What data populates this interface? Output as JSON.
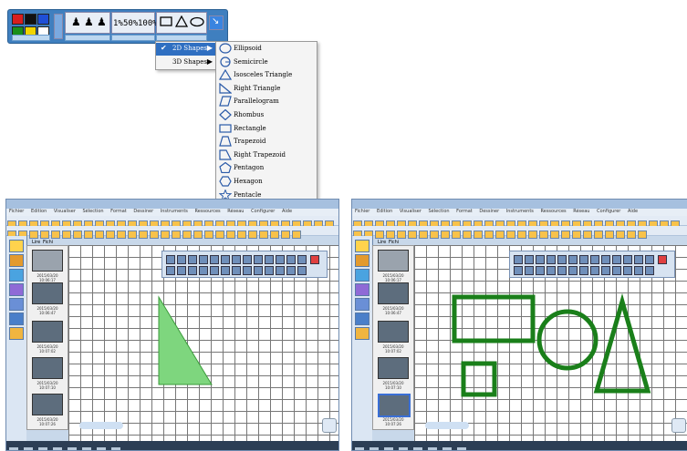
{
  "toolbar": {
    "colors": [
      "#d81e1e",
      "#111111",
      "#1f4fd6",
      "#1a8f1a",
      "#f0d400",
      "#ffffff"
    ],
    "thickness_labels": [
      "1%",
      "50%",
      "100%"
    ],
    "shape_icons": [
      "rectangle-icon",
      "triangle-icon",
      "ellipse-icon"
    ]
  },
  "shapes_menu": {
    "items": [
      {
        "label": "2D Shapes",
        "selected": true
      },
      {
        "label": "3D Shapes",
        "selected": false
      }
    ]
  },
  "shapes_2d_submenu": {
    "items": [
      {
        "label": "Ellipsoid",
        "icon": "ellipse-icon"
      },
      {
        "label": "Semicircle",
        "icon": "semicircle-icon"
      },
      {
        "label": "Isosceles Triangle",
        "icon": "isosceles-triangle-icon"
      },
      {
        "label": "Right Triangle",
        "icon": "right-triangle-icon"
      },
      {
        "label": "Parallelogram",
        "icon": "parallelogram-icon"
      },
      {
        "label": "Rhombus",
        "icon": "rhombus-icon"
      },
      {
        "label": "Rectangle",
        "icon": "rectangle-icon"
      },
      {
        "label": "Trapezoid",
        "icon": "trapezoid-icon"
      },
      {
        "label": "Right Trapezoid",
        "icon": "right-trapezoid-icon"
      },
      {
        "label": "Pentagon",
        "icon": "pentagon-icon"
      },
      {
        "label": "Hexagon",
        "icon": "hexagon-icon"
      },
      {
        "label": "Pentacle",
        "icon": "pentacle-icon"
      }
    ]
  },
  "app_left": {
    "title": "",
    "shape_color": "#7ed67e",
    "thumb_captions": [
      "2015/03/20 10:06:17",
      "2015/03/20 10:06:47",
      "2015/03/20 10:07:02",
      "2015/03/20 10:07:10",
      "2015/03/20 10:07:26"
    ]
  },
  "app_right": {
    "title": "",
    "shape_color": "#1a7f1a",
    "thumb_captions": [
      "2015/03/20 10:06:17",
      "2015/03/20 10:06:47",
      "2015/03/20 10:07:02",
      "2015/03/20 10:07:10",
      "2015/03/20 10:07:26"
    ]
  },
  "menubar": [
    "Fichier",
    "Edition",
    "Visualiser",
    "Sélection",
    "Format",
    "Dessiner",
    "Instruments",
    "Ressources",
    "Réseau",
    "Configurer",
    "Aide"
  ],
  "tabs": [
    "Lire",
    "Fichi"
  ]
}
